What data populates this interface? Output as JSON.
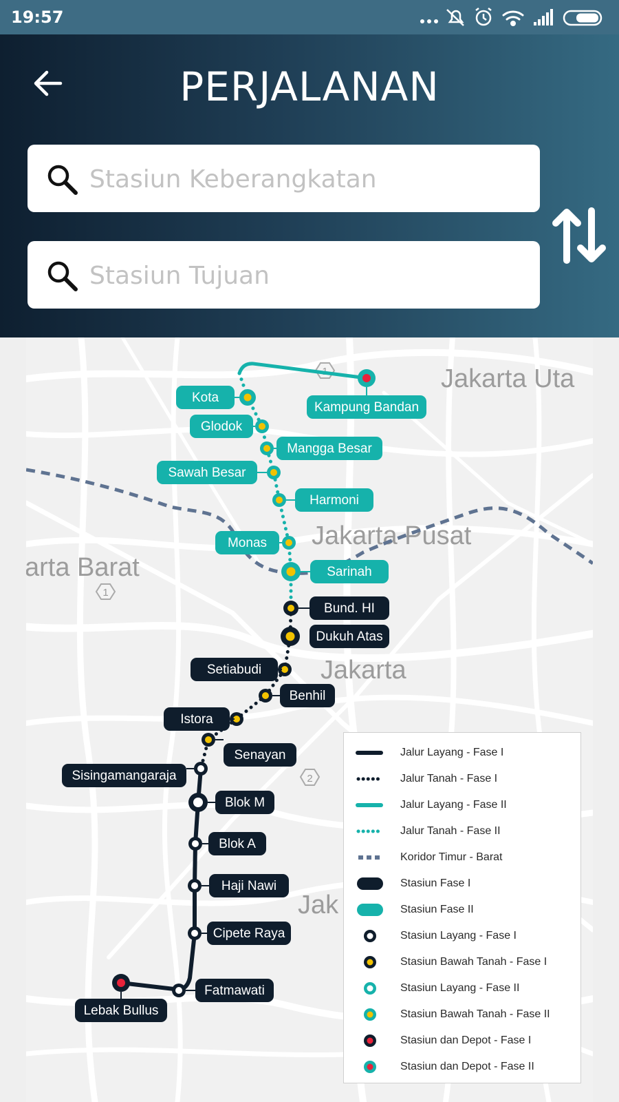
{
  "status_bar": {
    "time": "19:57"
  },
  "header": {
    "title": "PERJALANAN",
    "departure_placeholder": "Stasiun Keberangkatan",
    "departure_value": "",
    "destination_placeholder": "Stasiun Tujuan",
    "destination_value": ""
  },
  "map": {
    "districts": [
      "Jakarta Uta",
      "Jakarta Pusat",
      "arta Barat",
      "Jakarta",
      "Jak"
    ],
    "route_markers": [
      "1",
      "1",
      "2"
    ],
    "stations": {
      "kota": "Kota",
      "kampung_bandan": "Kampung Bandan",
      "glodok": "Glodok",
      "mangga_besar": "Mangga Besar",
      "sawah_besar": "Sawah Besar",
      "harmoni": "Harmoni",
      "monas": "Monas",
      "sarinah": "Sarinah",
      "bund_hi": "Bund. HI",
      "dukuh_atas": "Dukuh Atas",
      "setiabudi": "Setiabudi",
      "benhil": "Benhil",
      "istora": "Istora",
      "senayan": "Senayan",
      "sisingamangaraja": "Sisingamangaraja",
      "blok_m": "Blok M",
      "blok_a": "Blok A",
      "haji_nawi": "Haji Nawi",
      "cipete_raya": "Cipete Raya",
      "fatmawati": "Fatmawati",
      "lebak_bullus": "Lebak Bullus"
    }
  },
  "legend": [
    {
      "label": "Jalur Layang - Fase I",
      "symbol": "line-solid",
      "color": "#0f1d2c"
    },
    {
      "label": "Jalur Tanah - Fase I",
      "symbol": "line-dotted",
      "color": "#0f1d2c"
    },
    {
      "label": "Jalur Layang - Fase II",
      "symbol": "line-solid",
      "color": "#16b2ab"
    },
    {
      "label": "Jalur Tanah - Fase II",
      "symbol": "line-dotted",
      "color": "#16b2ab"
    },
    {
      "label": "Koridor Timur - Barat",
      "symbol": "line-dashed",
      "color": "#5f7391"
    },
    {
      "label": "Stasiun Fase I",
      "symbol": "pill",
      "color": "#0f1d2c"
    },
    {
      "label": "Stasiun Fase II",
      "symbol": "pill",
      "color": "#16b2ab"
    },
    {
      "label": "Stasiun Layang - Fase I",
      "symbol": "dot",
      "color": "#0f1d2c",
      "center": "#ffffff"
    },
    {
      "label": "Stasiun Bawah Tanah - Fase I",
      "symbol": "dot",
      "color": "#0f1d2c",
      "center": "#f2c200"
    },
    {
      "label": "Stasiun Layang - Fase II",
      "symbol": "dot",
      "color": "#16b2ab",
      "center": "#ffffff"
    },
    {
      "label": "Stasiun Bawah Tanah - Fase II",
      "symbol": "dot",
      "color": "#16b2ab",
      "center": "#f2c200"
    },
    {
      "label": "Stasiun dan Depot - Fase I",
      "symbol": "dot",
      "color": "#0f1d2c",
      "center": "#e8223a"
    },
    {
      "label": "Stasiun dan Depot - Fase II",
      "symbol": "dot",
      "color": "#16b2ab",
      "center": "#e8223a"
    }
  ],
  "colors": {
    "phase1": "#0f1d2c",
    "phase2": "#16b2ab",
    "underground_center": "#f2c200",
    "depot_center": "#e8223a",
    "corridor": "#5f7391"
  }
}
